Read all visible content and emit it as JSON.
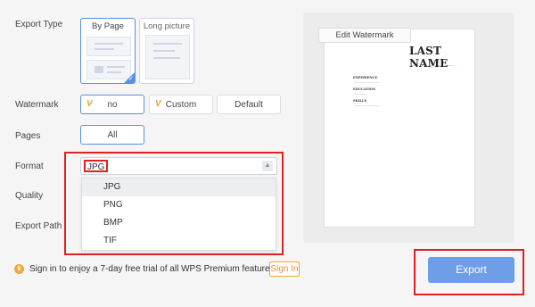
{
  "labels": {
    "export_type": "Export Type",
    "watermark": "Watermark",
    "pages": "Pages",
    "format": "Format",
    "quality": "Quality",
    "export_path": "Export Path"
  },
  "export_type": {
    "options": [
      {
        "label": "By Page",
        "selected": true
      },
      {
        "label": "Long picture",
        "selected": false
      }
    ]
  },
  "watermark": {
    "options": [
      {
        "label": "no",
        "vip": true,
        "selected": true
      },
      {
        "label": "Custom",
        "vip": true,
        "selected": false
      },
      {
        "label": "Default",
        "vip": false,
        "selected": false
      }
    ]
  },
  "pages": {
    "value": "All"
  },
  "format": {
    "value": "JPG",
    "options": [
      "JPG",
      "PNG",
      "BMP",
      "TIF"
    ],
    "highlighted": "JPG"
  },
  "preview": {
    "edit_watermark": "Edit Watermark",
    "doc_title": "LAST NAME",
    "sections": [
      "EXPERIENCE",
      "EDUCATION",
      "SKILLS"
    ]
  },
  "promo": {
    "text": "Sign in to enjoy a 7-day free trial of all WPS Premium features",
    "signin": "Sign In"
  },
  "export_button": "Export",
  "colors": {
    "accent": "#5a8fe6",
    "export_button": "#6f9ee8",
    "highlight_red": "#e02020",
    "promo_orange": "#f0a63a"
  }
}
